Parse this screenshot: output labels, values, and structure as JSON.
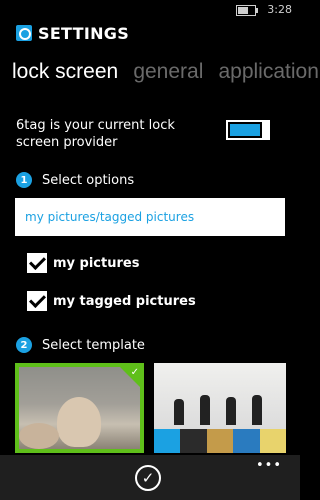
{
  "status": {
    "time": "3:28"
  },
  "header": {
    "app_title": "SETTINGS"
  },
  "pivot": {
    "items": [
      "lock screen",
      "general",
      "application"
    ]
  },
  "lock": {
    "provider_text": "6tag is your current lock screen provider",
    "toggle_on": true
  },
  "step1": {
    "number": "1",
    "label": "Select options"
  },
  "options_value": "my pictures/tagged pictures",
  "checkboxes": [
    {
      "label": "my pictures",
      "checked": true
    },
    {
      "label": "my tagged pictures",
      "checked": true
    }
  ],
  "step2": {
    "number": "2",
    "label": "Select template"
  },
  "templates": [
    {
      "selected": true
    },
    {
      "selected": false
    }
  ],
  "appbar": {
    "more": "•••"
  },
  "colors": {
    "accent": "#1ba1e2",
    "selected": "#5fbf1a"
  }
}
